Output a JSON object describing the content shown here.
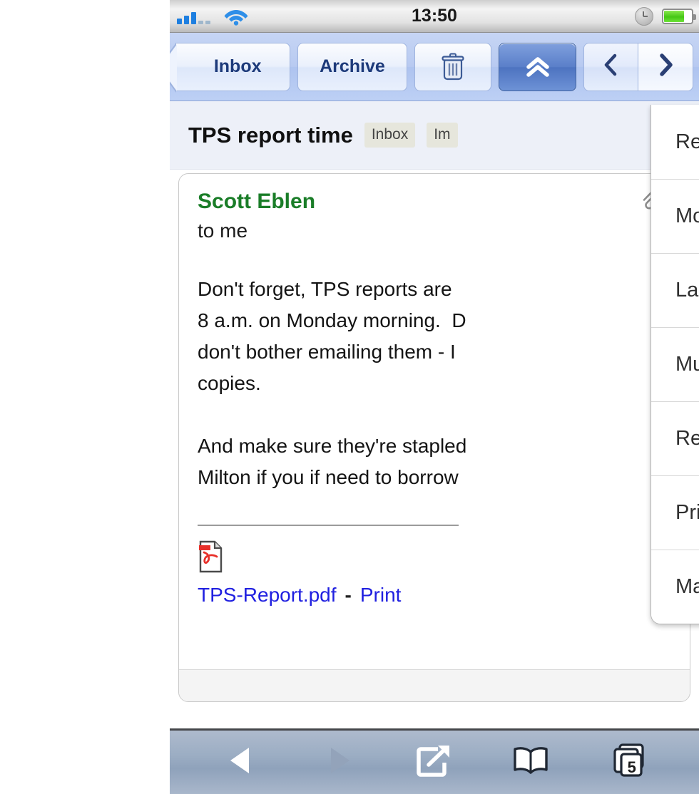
{
  "status_bar": {
    "carrier_signal_icon": "signal-bars-icon",
    "wifi_icon": "wifi-icon",
    "time": "13:50",
    "alarm_icon": "clock-icon",
    "battery_icon": "battery-icon",
    "battery_level_percent": 74
  },
  "gmail_toolbar": {
    "back_label": "Inbox",
    "archive_label": "Archive",
    "delete_icon": "trash-icon",
    "more_actions_icon": "double-chevron-up-icon",
    "more_actions_active": true,
    "prev_icon": "chevron-left-icon",
    "next_icon": "chevron-right-icon"
  },
  "subject": {
    "title": "TPS report time",
    "labels": [
      "Inbox",
      "Im"
    ]
  },
  "message": {
    "sender": "Scott Eblen",
    "attachment_indicator_icon": "paperclip-icon",
    "recipients": "to me",
    "body": "Don't forget, TPS reports are \n8 a.m. on Monday morning.  D\ndon't bother emailing them - I\ncopies.\n\nAnd make sure they're stapled\nMilton if you if need to borrow",
    "attachment": {
      "file_icon": "pdf-file-icon",
      "filename": "TPS-Report.pdf",
      "separator": "-",
      "action_label": "Print"
    }
  },
  "action_menu": {
    "items": [
      {
        "label": "Reply"
      },
      {
        "label": "Move..."
      },
      {
        "label": "Label..."
      },
      {
        "label": "Mute"
      },
      {
        "label": "Report spam"
      },
      {
        "label": "Print"
      },
      {
        "label": "Mark as unread"
      }
    ]
  },
  "safari_toolbar": {
    "back_icon": "back-triangle-icon",
    "forward_icon": "forward-triangle-icon",
    "share_icon": "share-arrow-icon",
    "bookmarks_icon": "book-icon",
    "tabs_icon": "tabs-icon",
    "tab_count": "5"
  },
  "colors": {
    "toolbar_blue": "#aec3ef",
    "active_button_blue": "#5a7fc9",
    "sender_green": "#1a7d28",
    "link_blue": "#2020e0",
    "battery_green": "#45c614"
  }
}
